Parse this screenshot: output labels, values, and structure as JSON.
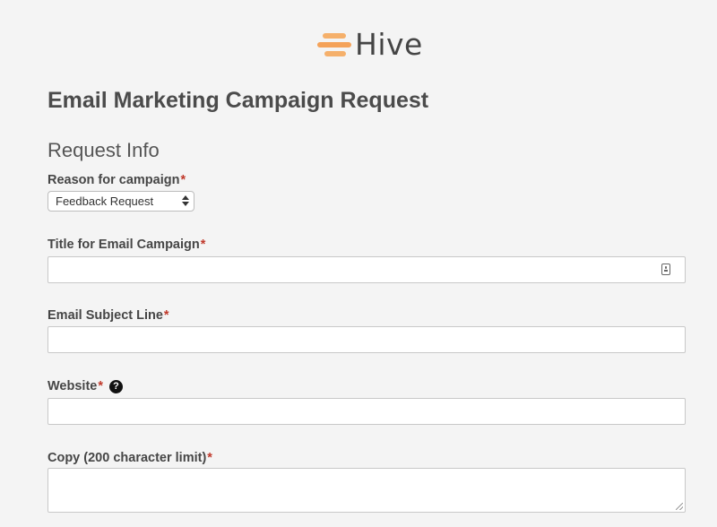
{
  "brand": {
    "name": "Hive",
    "accent_color": "#f4a259"
  },
  "form": {
    "title": "Email Marketing Campaign Request",
    "section_title": "Request Info",
    "required_marker": "*",
    "help_glyph": "?",
    "fields": {
      "reason": {
        "label": "Reason for campaign",
        "selected": "Feedback Request"
      },
      "title": {
        "label": "Title for Email Campaign",
        "value": "",
        "icon": "contact-card-icon"
      },
      "subject": {
        "label": "Email Subject Line",
        "value": ""
      },
      "website": {
        "label": "Website",
        "value": "",
        "icon": "help-icon"
      },
      "copy": {
        "label": "Copy (200 character limit)",
        "value": ""
      }
    }
  }
}
